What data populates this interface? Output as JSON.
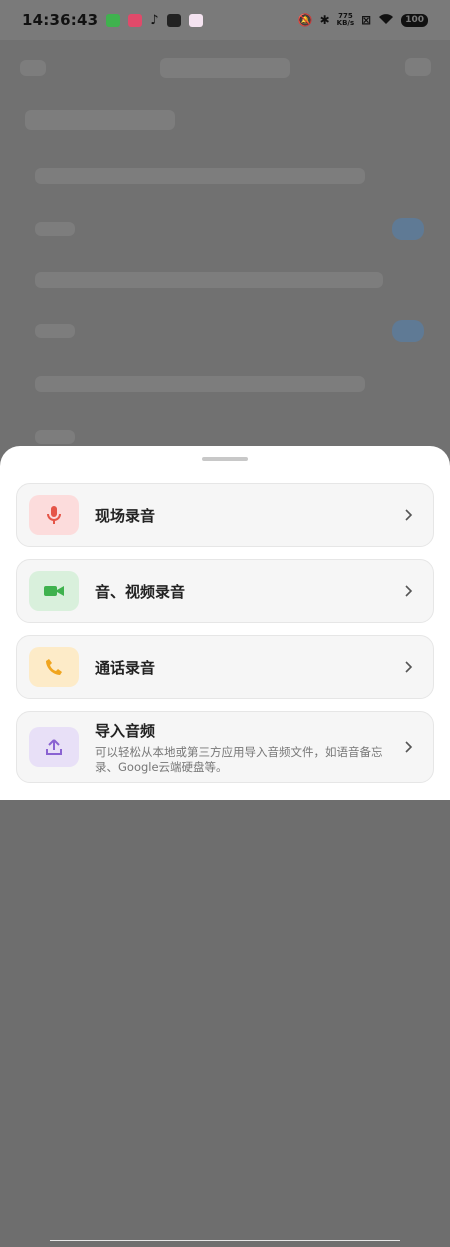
{
  "status_bar": {
    "time": "14:36:43",
    "net_speed_value": "775",
    "net_speed_unit": "KB/s",
    "battery": "100"
  },
  "sheet": {
    "options": [
      {
        "title": "现场录音",
        "icon": "microphone-icon",
        "icon_bg": "#fcdcdc",
        "icon_color": "#e55548"
      },
      {
        "title": "音、视频录音",
        "icon": "video-camera-icon",
        "icon_bg": "#d9f0dc",
        "icon_color": "#3fb24e"
      },
      {
        "title": "通话录音",
        "icon": "phone-icon",
        "icon_bg": "#fdebc8",
        "icon_color": "#f0a51f"
      },
      {
        "title": "导入音频",
        "description": "可以轻松从本地或第三方应用导入音频文件，如语音备忘录、Google云端硬盘等。",
        "icon": "upload-icon",
        "icon_bg": "#e8e0f7",
        "icon_color": "#8a63d2"
      }
    ]
  }
}
